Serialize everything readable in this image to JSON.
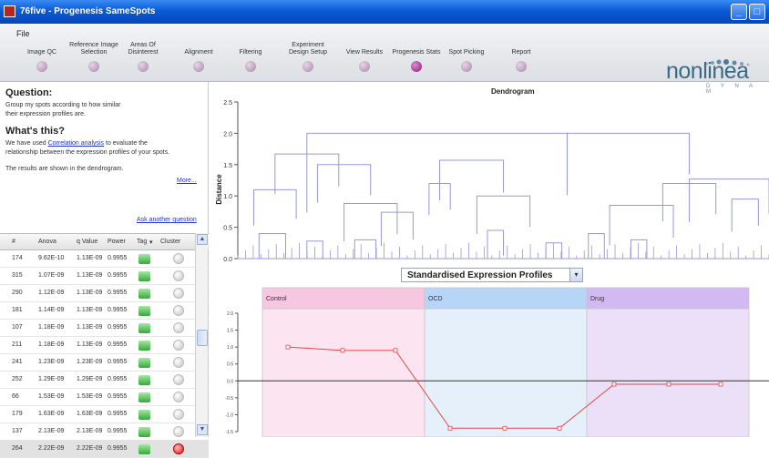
{
  "window": {
    "title": "76five - Progenesis SameSpots"
  },
  "menu": {
    "file": "File"
  },
  "workflow": [
    {
      "label": "Image QC",
      "active": false
    },
    {
      "label": "Reference Image\nSelection",
      "active": false
    },
    {
      "label": "Areas Of\nDisinterest",
      "active": false
    },
    {
      "label": "Alignment",
      "active": false
    },
    {
      "label": "Filtering",
      "active": false
    },
    {
      "label": "Experiment\nDesign Setup",
      "active": false
    },
    {
      "label": "View Results",
      "active": false
    },
    {
      "label": "Progenesis Stats",
      "active": true
    },
    {
      "label": "Spot Picking",
      "active": false
    },
    {
      "label": "Report",
      "active": false
    }
  ],
  "brand": {
    "name": "nonlinea",
    "sub": "D Y N A M"
  },
  "question": {
    "heading": "Question:",
    "body_line1": "Group my spots according to how similar",
    "body_line2": "their expression profiles are."
  },
  "whats_this": {
    "heading": "What's this?",
    "line1_pre": "We have used ",
    "link": "Correlation analysis",
    "line1_post": " to evaluate the",
    "line2": "relationship between the expression profiles of your spots.",
    "line3": "The results are shown in the dendrogram.",
    "more": "More...",
    "ask": "Ask another question"
  },
  "table": {
    "columns": [
      "#",
      "Anova",
      "q Value",
      "Power",
      "Tag",
      "Cluster"
    ],
    "rows": [
      {
        "id": "174",
        "anova": "9.62E-10",
        "q": "1.13E-09",
        "power": "0.9955",
        "tag": "green",
        "cluster": "grey"
      },
      {
        "id": "315",
        "anova": "1.07E-09",
        "q": "1.13E-09",
        "power": "0.9955",
        "tag": "green",
        "cluster": "grey"
      },
      {
        "id": "290",
        "anova": "1.12E-09",
        "q": "1.13E-09",
        "power": "0.9955",
        "tag": "green",
        "cluster": "grey"
      },
      {
        "id": "181",
        "anova": "1.14E-09",
        "q": "1.13E-09",
        "power": "0.9955",
        "tag": "green",
        "cluster": "grey"
      },
      {
        "id": "107",
        "anova": "1.18E-09",
        "q": "1.13E-09",
        "power": "0.9955",
        "tag": "green",
        "cluster": "grey"
      },
      {
        "id": "211",
        "anova": "1.18E-09",
        "q": "1.13E-09",
        "power": "0.9955",
        "tag": "green",
        "cluster": "grey"
      },
      {
        "id": "241",
        "anova": "1.23E-09",
        "q": "1.23E-09",
        "power": "0.9955",
        "tag": "green",
        "cluster": "grey"
      },
      {
        "id": "252",
        "anova": "1.29E-09",
        "q": "1.29E-09",
        "power": "0.9955",
        "tag": "green",
        "cluster": "grey"
      },
      {
        "id": "66",
        "anova": "1.53E-09",
        "q": "1.53E-09",
        "power": "0.9955",
        "tag": "green",
        "cluster": "grey"
      },
      {
        "id": "179",
        "anova": "1.63E-09",
        "q": "1.63E-09",
        "power": "0.9955",
        "tag": "green",
        "cluster": "grey"
      },
      {
        "id": "137",
        "anova": "2.13E-09",
        "q": "2.13E-09",
        "power": "0.9955",
        "tag": "green",
        "cluster": "grey"
      },
      {
        "id": "264",
        "anova": "2.22E-09",
        "q": "2.22E-09",
        "power": "0.9955",
        "tag": "green",
        "cluster": "red"
      }
    ]
  },
  "profiles": {
    "selected": "Standardised Expression Profiles"
  },
  "colors": {
    "accent": "#8a1a78",
    "dendro_line": "#9898dc",
    "profile_line": "#e04848",
    "control_bg": "#fce4f0",
    "control_hdr": "#f7c6e0",
    "ocd_bg": "#e6f0fb",
    "ocd_hdr": "#b7d5f6",
    "drug_bg": "#ece0f8",
    "drug_hdr": "#d3b9f2"
  },
  "chart_data": [
    {
      "type": "dendrogram",
      "title": "Dendrogram",
      "ylabel": "Distance",
      "ylim": [
        0,
        2.5
      ],
      "yticks": [
        "0.0",
        "0.5",
        "1.0",
        "1.5",
        "2.0",
        "2.5"
      ],
      "merges": [
        {
          "x1": 0.13,
          "x2": 0.62,
          "h": 2.0
        },
        {
          "x1": 0.62,
          "x2": 0.85,
          "h": 2.0
        },
        {
          "x1": 0.07,
          "x2": 0.19,
          "h": 1.67
        },
        {
          "x1": 0.03,
          "x2": 0.11,
          "h": 1.1
        },
        {
          "x1": 0.15,
          "x2": 0.25,
          "h": 1.5
        },
        {
          "x1": 0.2,
          "x2": 0.3,
          "h": 0.88
        },
        {
          "x1": 0.27,
          "x2": 0.33,
          "h": 0.74
        },
        {
          "x1": 0.38,
          "x2": 0.5,
          "h": 1.57
        },
        {
          "x1": 0.36,
          "x2": 0.4,
          "h": 1.2
        },
        {
          "x1": 0.45,
          "x2": 0.55,
          "h": 1.0
        },
        {
          "x1": 0.47,
          "x2": 0.5,
          "h": 0.45
        },
        {
          "x1": 0.85,
          "x2": 1.0,
          "h": 1.27
        },
        {
          "x1": 0.8,
          "x2": 0.9,
          "h": 1.2
        },
        {
          "x1": 0.7,
          "x2": 0.82,
          "h": 0.85
        },
        {
          "x1": 0.93,
          "x2": 0.98,
          "h": 0.95
        },
        {
          "x1": 0.04,
          "x2": 0.09,
          "h": 0.4
        },
        {
          "x1": 0.13,
          "x2": 0.16,
          "h": 0.28
        },
        {
          "x1": 0.22,
          "x2": 0.26,
          "h": 0.3
        },
        {
          "x1": 0.58,
          "x2": 0.61,
          "h": 0.25
        },
        {
          "x1": 0.66,
          "x2": 0.69,
          "h": 0.4
        },
        {
          "x1": 0.74,
          "x2": 0.77,
          "h": 0.3
        }
      ]
    },
    {
      "type": "line",
      "title": "Standardised Expression Profiles",
      "groups": [
        "Control",
        "OCD",
        "Drug"
      ],
      "ylim": [
        -15,
        20
      ],
      "yticks": [
        "2.0",
        "1.5",
        "1.0",
        "0.5",
        "0.0",
        "-0.5",
        "-1.0",
        "-1.5"
      ],
      "series": [
        {
          "values": [
            1.0,
            0.9,
            0.9,
            -1.4,
            -1.4,
            -1.4,
            -0.1,
            -0.1,
            -0.1
          ]
        }
      ]
    }
  ]
}
